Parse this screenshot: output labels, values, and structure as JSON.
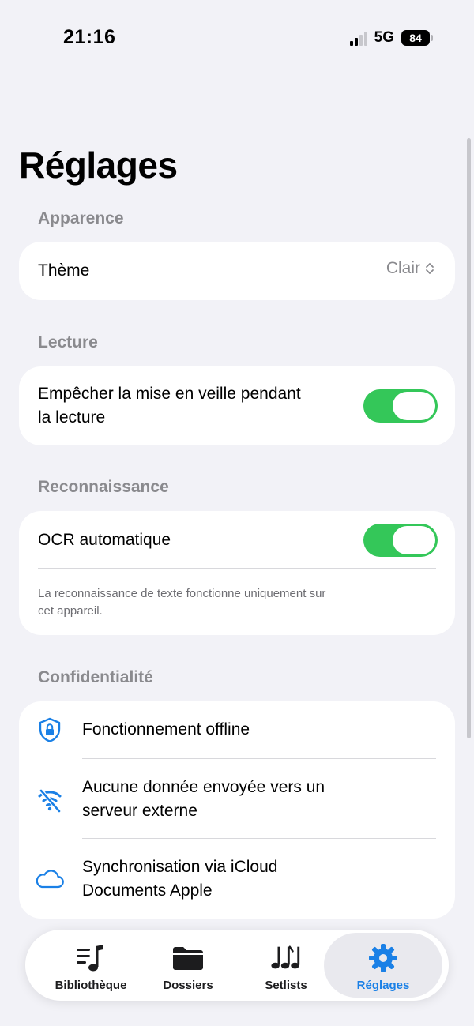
{
  "status": {
    "time": "21:16",
    "network": "5G",
    "battery": "84"
  },
  "title": "Réglages",
  "sections": {
    "appearance": {
      "header": "Apparence",
      "theme_label": "Thème",
      "theme_value": "Clair"
    },
    "playback": {
      "header": "Lecture",
      "prevent_sleep_line1": "Empêcher la mise en veille pendant",
      "prevent_sleep_line2": "la lecture",
      "prevent_sleep_on": true
    },
    "recognition": {
      "header": "Reconnaissance",
      "ocr_label": "OCR automatique",
      "ocr_on": true,
      "footnote_line1": "La reconnaissance de texte fonctionne uniquement sur",
      "footnote_line2": "cet appareil."
    },
    "privacy": {
      "header": "Confidentialité",
      "items": [
        {
          "icon": "shield-lock-icon",
          "line1": "Fonctionnement offline",
          "line2": ""
        },
        {
          "icon": "wifi-off-icon",
          "line1": "Aucune donnée envoyée vers un",
          "line2": "serveur externe"
        },
        {
          "icon": "cloud-icon",
          "line1": "Synchronisation via iCloud",
          "line2": "Documents Apple"
        }
      ]
    }
  },
  "tabs": [
    {
      "label": "Bibliothèque",
      "icon": "music-list-icon",
      "active": false
    },
    {
      "label": "Dossiers",
      "icon": "folder-icon",
      "active": false
    },
    {
      "label": "Setlists",
      "icon": "music-notes-icon",
      "active": false
    },
    {
      "label": "Réglages",
      "icon": "gear-icon",
      "active": true
    }
  ],
  "colors": {
    "accent": "#1a80e6",
    "toggle_on": "#34c759",
    "background": "#f2f2f7"
  }
}
